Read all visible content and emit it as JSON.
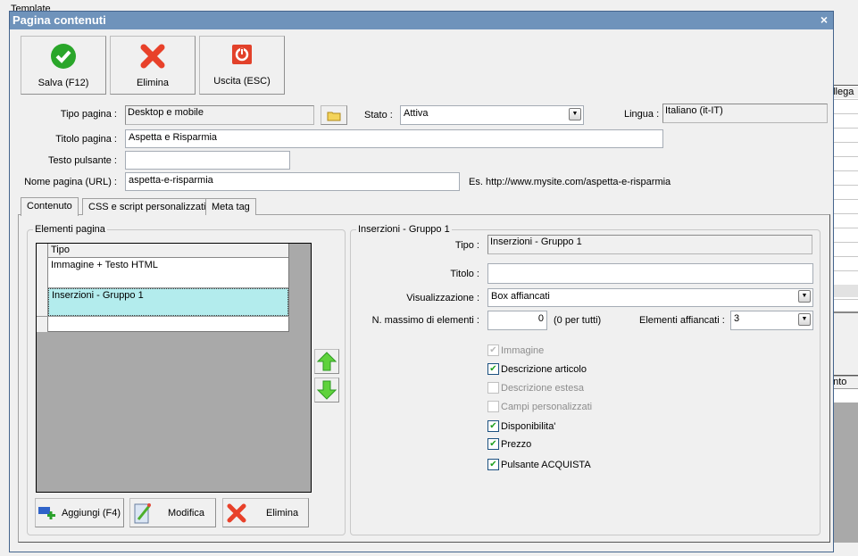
{
  "background": {
    "group_title": "Template",
    "col_header_1": "ollega",
    "col_header_2": "ento"
  },
  "dialog": {
    "title": "Pagina contenuti",
    "close": "×",
    "toolbar": {
      "save": "Salva (F12)",
      "delete": "Elimina",
      "exit": "Uscita (ESC)"
    },
    "form": {
      "tipo_pagina_label": "Tipo pagina :",
      "tipo_pagina_value": "Desktop e mobile",
      "stato_label": "Stato :",
      "stato_value": "Attiva",
      "lingua_label": "Lingua :",
      "lingua_value": "Italiano (it-IT)",
      "titolo_label": "Titolo pagina :",
      "titolo_value": "Aspetta e Risparmia",
      "testo_label": "Testo pulsante :",
      "testo_value": "",
      "nome_label": "Nome pagina (URL) :",
      "nome_value": "aspetta-e-risparmia",
      "url_example": "Es. http://www.mysite.com/aspetta-e-risparmia"
    },
    "tabs": [
      "Contenuto",
      "CSS e script personalizzati",
      "Meta tag"
    ],
    "elements": {
      "title": "Elementi pagina",
      "column": "Tipo",
      "rows": [
        "Immagine + Testo HTML",
        "Inserzioni - Gruppo 1"
      ],
      "selected_row": 1,
      "add": "Aggiungi (F4)",
      "edit": "Modifica",
      "delete": "Elimina"
    },
    "detail": {
      "title": "Inserzioni - Gruppo 1",
      "tipo_label": "Tipo :",
      "tipo_value": "Inserzioni - Gruppo 1",
      "titolo_label": "Titolo :",
      "titolo_value": "",
      "vis_label": "Visualizzazione :",
      "vis_value": "Box affiancati",
      "max_label": "N. massimo di elementi :",
      "max_value": "0",
      "max_hint": "(0 per tutti)",
      "aff_label": "Elementi affiancati :",
      "aff_value": "3",
      "checkboxes": [
        {
          "label": "Immagine",
          "checked": true,
          "enabled": false
        },
        {
          "label": "Descrizione articolo",
          "checked": true,
          "enabled": true
        },
        {
          "label": "Descrizione estesa",
          "checked": false,
          "enabled": false
        },
        {
          "label": "Campi personalizzati",
          "checked": false,
          "enabled": false
        },
        {
          "label": "Disponibilita'",
          "checked": true,
          "enabled": true
        },
        {
          "label": "Prezzo",
          "checked": true,
          "enabled": true
        },
        {
          "label": "Pulsante ACQUISTA",
          "checked": true,
          "enabled": true
        }
      ]
    }
  }
}
